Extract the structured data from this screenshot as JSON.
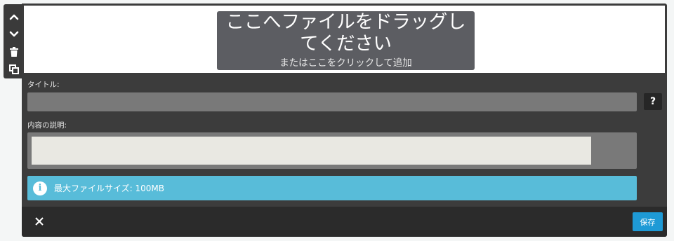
{
  "dropzone": {
    "title": "ここへファイルをドラッグしてください",
    "subtitle": "またはここをクリックして追加"
  },
  "form": {
    "title_label": "タイトル:",
    "title_value": "",
    "help_label": "?",
    "description_label": "内容の説明:",
    "description_value": ""
  },
  "info": {
    "icon": "info-icon",
    "text": "最大ファイルサイズ: 100MB"
  },
  "footer": {
    "close_icon": "close-icon",
    "save_label": "保存"
  },
  "toolbar": {
    "icons": [
      "chevron-up-icon",
      "chevron-down-icon",
      "trash-icon",
      "duplicate-icon"
    ]
  },
  "colors": {
    "panel": "#3c3c3c",
    "footer": "#2b2b2b",
    "info": "#58bcd9",
    "save": "#1e9ad6",
    "dropbox": "#5c5d62"
  }
}
